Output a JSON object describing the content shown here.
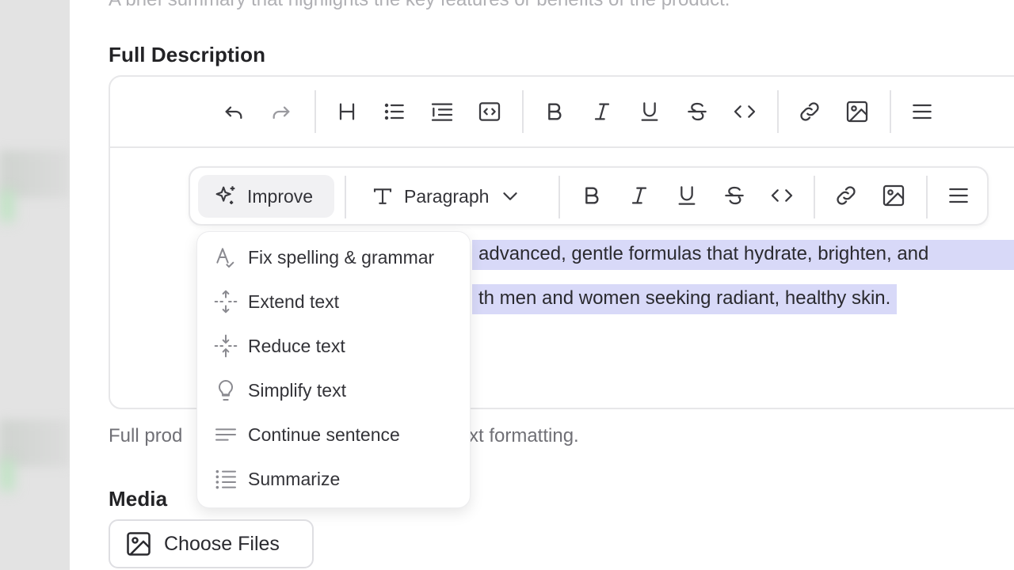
{
  "page": {
    "cut_hint": "A brief summary that highlights the key features or benefits of the product."
  },
  "description": {
    "label": "Full Description",
    "helper_text_start": "Full prod",
    "helper_text_end": "xt formatting."
  },
  "toolbar": {
    "icons": [
      "undo-icon",
      "redo-icon",
      "heading-icon",
      "bullet-list-icon",
      "ordered-list-icon",
      "code-block-icon",
      "bold-icon",
      "italic-icon",
      "underline-icon",
      "strikethrough-icon",
      "code-icon",
      "link-icon",
      "image-icon",
      "more-menu-icon"
    ]
  },
  "bubble": {
    "improve_label": "Improve",
    "paragraph_label": "Paragraph"
  },
  "content": {
    "line1": "advanced, gentle formulas that hydrate, brighten, and",
    "line2": "th men and women seeking radiant, healthy skin."
  },
  "improve_menu": {
    "items": [
      {
        "label": "Fix spelling & grammar",
        "icon": "spellcheck-icon"
      },
      {
        "label": "Extend text",
        "icon": "extend-icon"
      },
      {
        "label": "Reduce text",
        "icon": "reduce-icon"
      },
      {
        "label": "Simplify text",
        "icon": "lightbulb-icon"
      },
      {
        "label": "Continue sentence",
        "icon": "continue-icon"
      },
      {
        "label": "Summarize",
        "icon": "summarize-icon"
      }
    ]
  },
  "media": {
    "label": "Media",
    "choose_files_label": "Choose Files"
  },
  "colors": {
    "selection": "#d8d9f8",
    "icon": "#3a3a3f",
    "border": "#e7e7e9"
  }
}
